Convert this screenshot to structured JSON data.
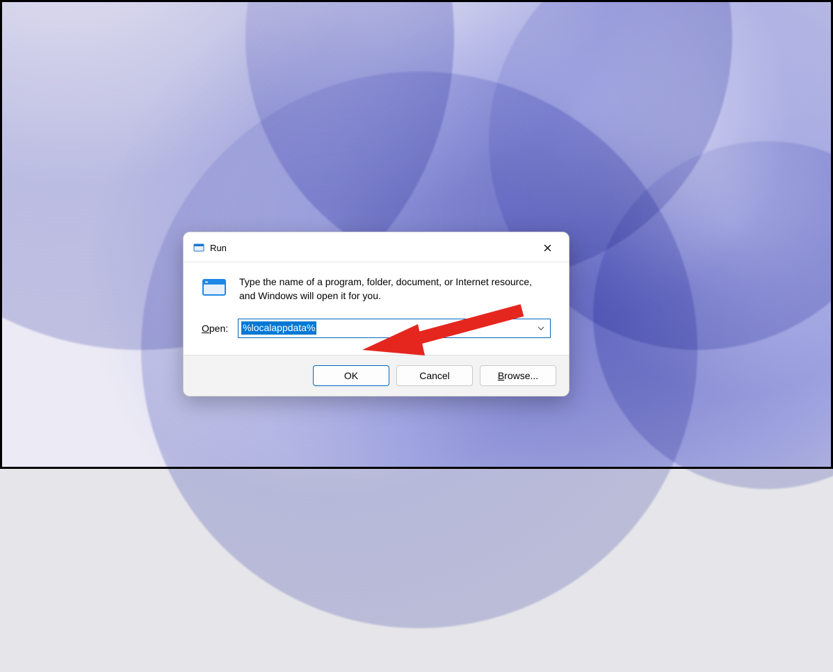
{
  "dialog": {
    "title": "Run",
    "description": "Type the name of a program, folder, document, or Internet resource, and Windows will open it for you.",
    "open_label_prefix": "O",
    "open_label_rest": "pen:",
    "input_value": "%localappdata%",
    "buttons": {
      "ok": "OK",
      "cancel": "Cancel",
      "browse_prefix": "B",
      "browse_rest": "rowse..."
    }
  }
}
